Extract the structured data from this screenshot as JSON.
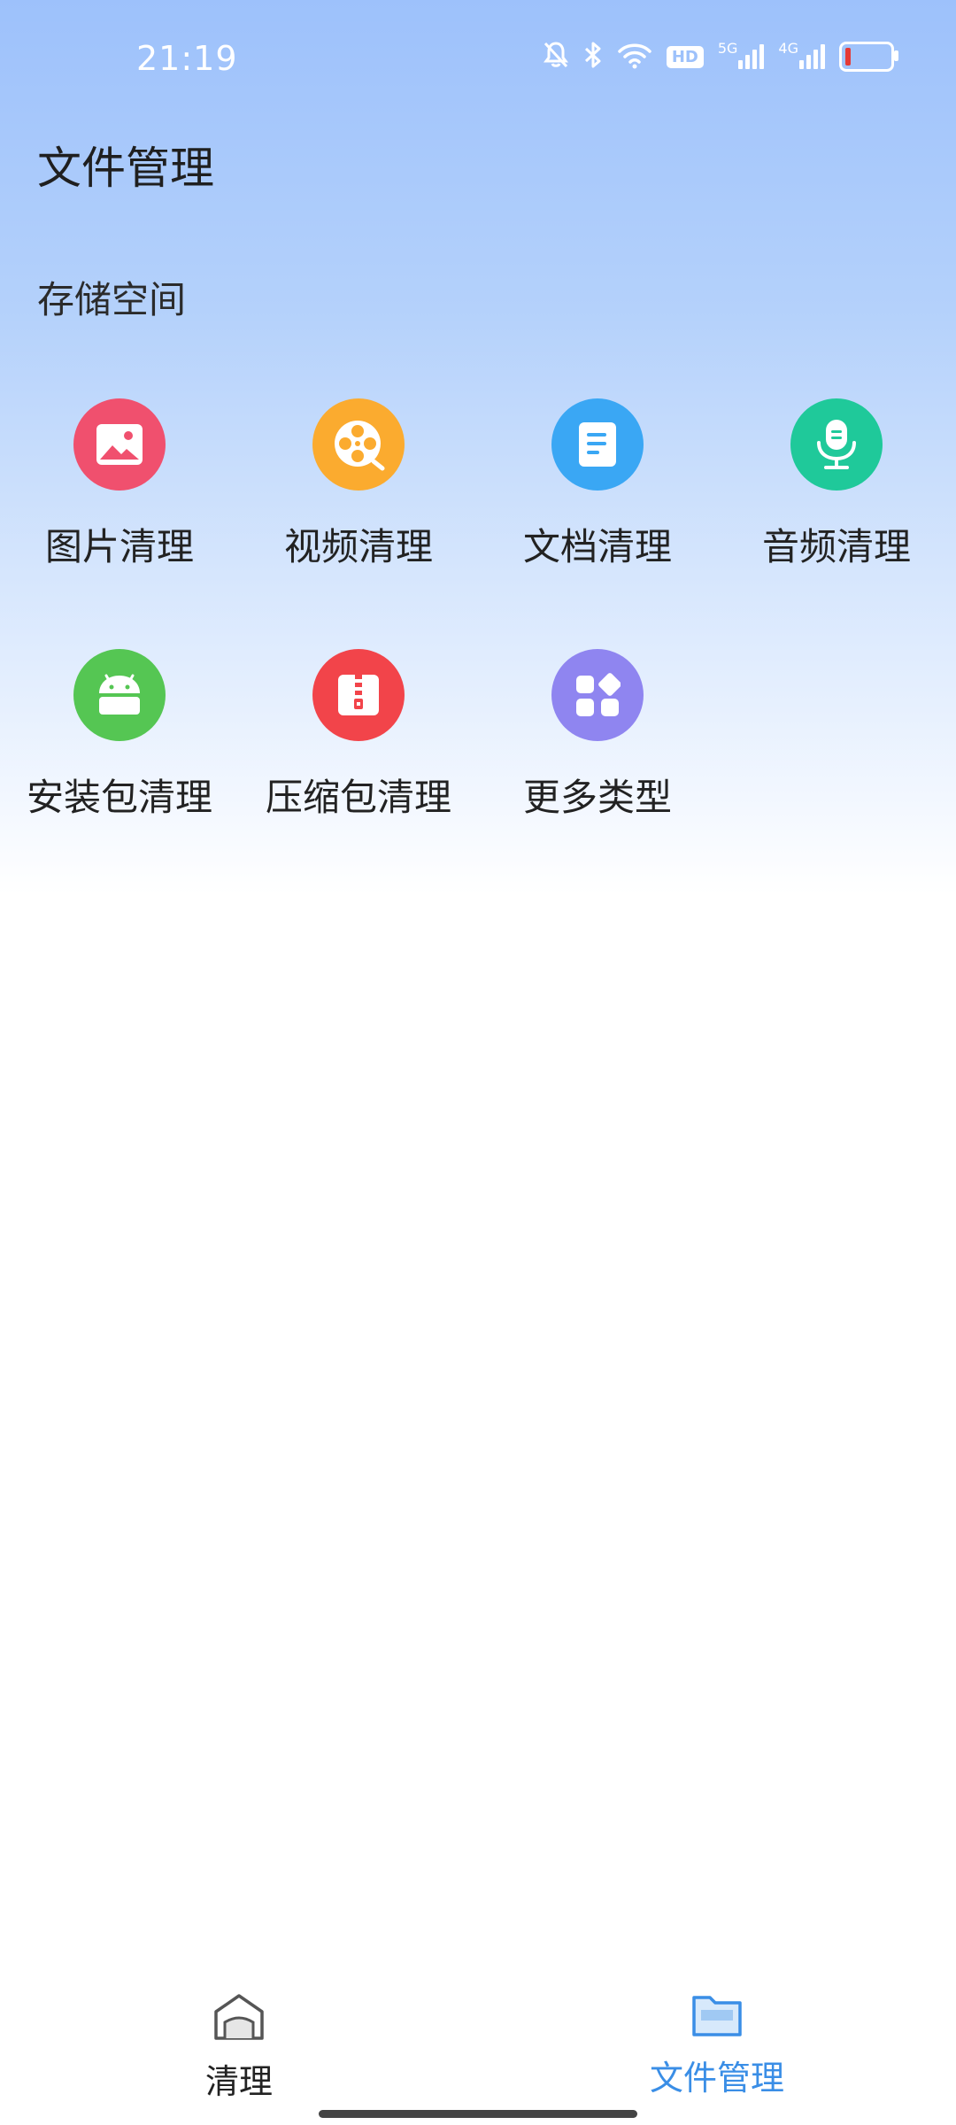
{
  "status_bar": {
    "time": "21:19",
    "hd_badge": "HD",
    "net1_label": "5G",
    "net2_label": "4G",
    "icons": [
      "bell-off-icon",
      "bluetooth-icon",
      "wifi-icon",
      "hd-badge",
      "signal-5g-icon",
      "signal-4g-icon",
      "battery-icon"
    ]
  },
  "header": {
    "title": "文件管理"
  },
  "storage": {
    "section_title": "存储空间",
    "categories": [
      {
        "label": "图片清理",
        "icon": "image-icon",
        "color": "#f0506e"
      },
      {
        "label": "视频清理",
        "icon": "film-reel-icon",
        "color": "#fbab2f"
      },
      {
        "label": "文档清理",
        "icon": "document-icon",
        "color": "#3aa7f4"
      },
      {
        "label": "音频清理",
        "icon": "microphone-icon",
        "color": "#1fc99a"
      },
      {
        "label": "安装包清理",
        "icon": "android-icon",
        "color": "#55c653"
      },
      {
        "label": "压缩包清理",
        "icon": "zip-icon",
        "color": "#f2444a"
      },
      {
        "label": "更多类型",
        "icon": "grid-more-icon",
        "color": "#8f85f0"
      }
    ]
  },
  "bottom_nav": {
    "items": [
      {
        "label": "清理",
        "icon": "house-icon",
        "active": false
      },
      {
        "label": "文件管理",
        "icon": "folder-icon",
        "active": true
      }
    ],
    "active_color": "#3a8ee6"
  }
}
